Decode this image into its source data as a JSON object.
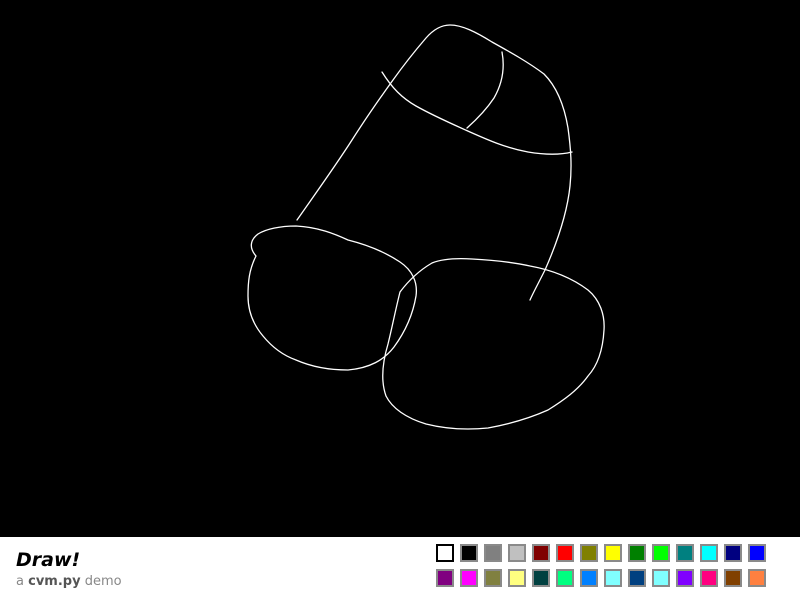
{
  "app": {
    "title": "Draw!",
    "subtitle_prefix": "a ",
    "subtitle_brand": "cvm.py",
    "subtitle_suffix": " demo"
  },
  "canvas": {
    "background": "#000000",
    "stroke_color": "#ffffff"
  },
  "palette": {
    "selected_index": 0,
    "rows": [
      [
        "#ffffff",
        "#000000",
        "#808080",
        "#c0c0c0",
        "#800000",
        "#ff0000",
        "#808000",
        "#ffff00",
        "#008000",
        "#00ff00",
        "#008080",
        "#00ffff",
        "#000080",
        "#0000ff"
      ],
      [
        "#800080",
        "#ff00ff",
        "#808040",
        "#ffff80",
        "#004040",
        "#00ff80",
        "#0080ff",
        "#80ffff",
        "#004080",
        "#80ffff",
        "#8000ff",
        "#ff0080",
        "#804000",
        "#ff8040"
      ]
    ]
  }
}
